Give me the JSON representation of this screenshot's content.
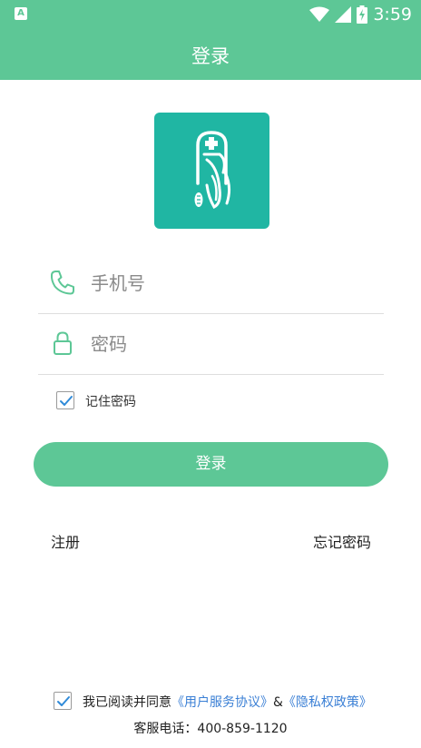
{
  "status_bar": {
    "app_icon_letter": "A",
    "time": "3:59",
    "icons": [
      "wifi-icon",
      "cellular-signal-icon",
      "battery-charging-icon"
    ]
  },
  "header": {
    "title": "登录"
  },
  "logo": {
    "icon": "medical-app-logo-icon",
    "brand_color": "#20b6a3"
  },
  "form": {
    "phone": {
      "icon": "phone-icon",
      "value": "",
      "placeholder": "手机号"
    },
    "password": {
      "icon": "lock-icon",
      "value": "",
      "placeholder": "密码"
    },
    "remember": {
      "label": "记住密码",
      "checked": true
    }
  },
  "actions": {
    "login_label": "登录",
    "register_label": "注册",
    "forgot_label": "忘记密码"
  },
  "agreement": {
    "checked": true,
    "prefix": "我已阅读并同意",
    "user_agreement": "《用户服务协议》",
    "separator": "&",
    "privacy_policy": "《隐私权政策》"
  },
  "hotline": "客服电话：400-859-1120",
  "colors": {
    "accent": "#5dc796",
    "link": "#3a7fd5",
    "check": "#2f8ad8"
  }
}
